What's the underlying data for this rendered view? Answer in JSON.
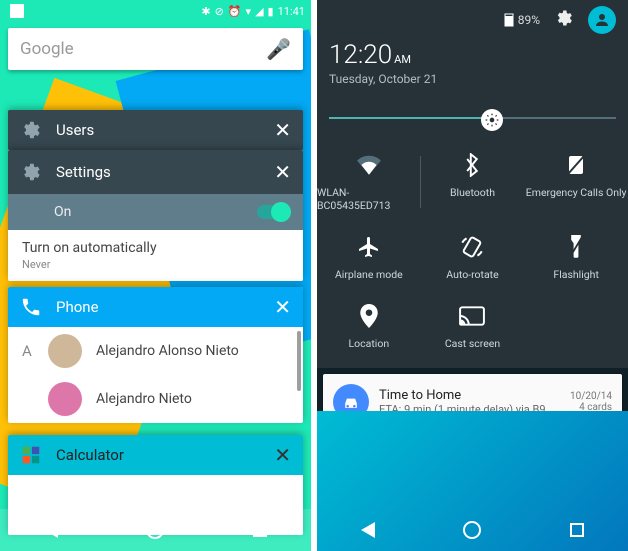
{
  "left": {
    "status_time": "11:41",
    "search_placeholder": "Google",
    "cards": {
      "users": {
        "title": "Users"
      },
      "settings": {
        "title": "Settings",
        "toggle_label": "On",
        "auto_label": "Turn on automatically",
        "auto_value": "Never"
      },
      "phone": {
        "title": "Phone",
        "alpha": "A",
        "contacts": [
          "Alejandro Alonso Nieto",
          "Alejandro Nieto"
        ]
      },
      "calculator": {
        "title": "Calculator"
      }
    }
  },
  "right": {
    "battery": "89%",
    "time": "12:20",
    "ampm": "AM",
    "date": "Tuesday, October 21",
    "tiles": {
      "wifi": "WLAN-BC05435ED713",
      "bluetooth": "Bluetooth",
      "emergency": "Emergency Calls Only",
      "airplane": "Airplane mode",
      "rotate": "Auto-rotate",
      "flashlight": "Flashlight",
      "location": "Location",
      "cast": "Cast screen"
    },
    "notification": {
      "title": "Time to Home",
      "subtitle": "ETA: 9 min (1 minute delay) via B9…",
      "date": "10/20/14",
      "count": "4 cards"
    }
  }
}
